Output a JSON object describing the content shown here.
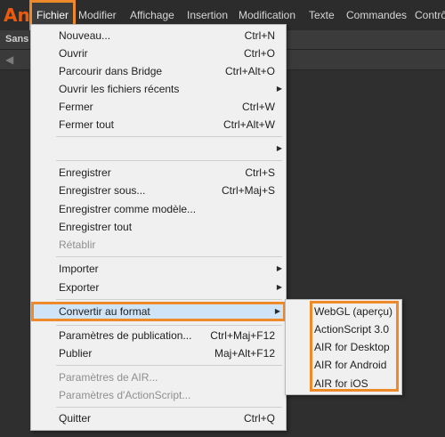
{
  "app": {
    "logo": "An"
  },
  "menubar": {
    "items": [
      {
        "label": "Fichier"
      },
      {
        "label": "Modifier"
      },
      {
        "label": "Affichage"
      },
      {
        "label": "Insertion"
      },
      {
        "label": "Modification"
      },
      {
        "label": "Texte"
      },
      {
        "label": "Commandes"
      },
      {
        "label": "Contrô"
      }
    ]
  },
  "document": {
    "tab_label": "Sans n"
  },
  "file_menu": {
    "items": [
      {
        "label": "Nouveau...",
        "shortcut": "Ctrl+N"
      },
      {
        "label": "Ouvrir",
        "shortcut": "Ctrl+O"
      },
      {
        "label": "Parcourir dans Bridge",
        "shortcut": "Ctrl+Alt+O"
      },
      {
        "label": "Ouvrir les fichiers récents",
        "shortcut": ""
      },
      {
        "label": "Fermer",
        "shortcut": "Ctrl+W"
      },
      {
        "label": "Fermer tout",
        "shortcut": "Ctrl+Alt+W"
      },
      {
        "label": "",
        "shortcut": ""
      },
      {
        "label": "Enregistrer",
        "shortcut": "Ctrl+S"
      },
      {
        "label": "Enregistrer sous...",
        "shortcut": "Ctrl+Maj+S"
      },
      {
        "label": "Enregistrer comme modèle...",
        "shortcut": ""
      },
      {
        "label": "Enregistrer tout",
        "shortcut": ""
      },
      {
        "label": "Rétablir",
        "shortcut": ""
      },
      {
        "label": "Importer",
        "shortcut": ""
      },
      {
        "label": "Exporter",
        "shortcut": ""
      },
      {
        "label": "Convertir au format",
        "shortcut": ""
      },
      {
        "label": "Paramètres de publication...",
        "shortcut": "Ctrl+Maj+F12"
      },
      {
        "label": "Publier",
        "shortcut": "Maj+Alt+F12"
      },
      {
        "label": "Paramètres de AIR...",
        "shortcut": ""
      },
      {
        "label": "Paramètres d'ActionScript...",
        "shortcut": ""
      },
      {
        "label": "Quitter",
        "shortcut": "Ctrl+Q"
      }
    ]
  },
  "convert_submenu": {
    "items": [
      {
        "label": "WebGL (aperçu)"
      },
      {
        "label": "ActionScript 3.0"
      },
      {
        "label": "AIR for Desktop"
      },
      {
        "label": "AIR for Android"
      },
      {
        "label": "AIR for iOS"
      }
    ]
  },
  "colors": {
    "highlight_frame": "#ef8a2a",
    "menu_background": "#f0f0f0",
    "app_background": "#2f2f2f"
  }
}
